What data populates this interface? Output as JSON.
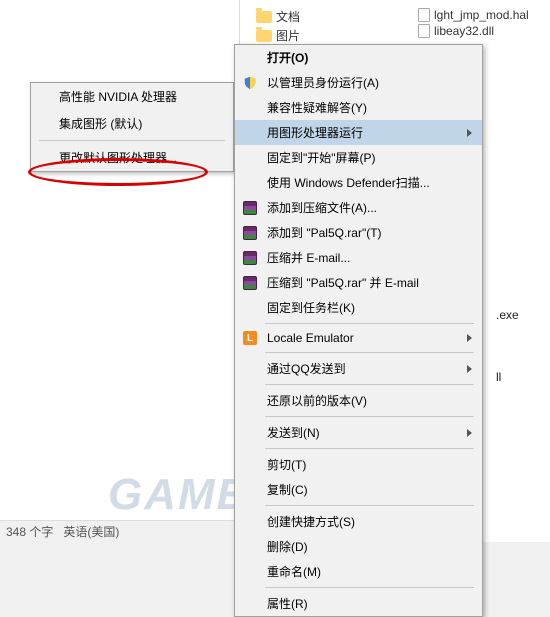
{
  "background": {
    "folders": [
      "文档",
      "图片"
    ],
    "files": [
      "lght_jmp_mod.hal",
      "libeay32.dll"
    ],
    "ext_exe": ".exe",
    "ext_ll": "ll"
  },
  "submenu": {
    "items": [
      {
        "label": "高性能 NVIDIA 处理器"
      },
      {
        "label": "集成图形   (默认)"
      },
      {
        "label": "更改默认图形处理器..."
      }
    ]
  },
  "ctxmenu": {
    "items": [
      {
        "label": "打开(O)",
        "bold": true
      },
      {
        "label": "以管理员身份运行(A)",
        "icon": "shield"
      },
      {
        "label": "兼容性疑难解答(Y)"
      },
      {
        "label": "用图形处理器运行",
        "arrow": true,
        "highlighted": true
      },
      {
        "label": "固定到\"开始\"屏幕(P)"
      },
      {
        "label": "使用 Windows Defender扫描..."
      },
      {
        "label": "添加到压缩文件(A)...",
        "icon": "winrar"
      },
      {
        "label": "添加到 \"Pal5Q.rar\"(T)",
        "icon": "winrar"
      },
      {
        "label": "压缩并 E-mail...",
        "icon": "winrar"
      },
      {
        "label": "压缩到 \"Pal5Q.rar\" 并 E-mail",
        "icon": "winrar"
      },
      {
        "label": "固定到任务栏(K)"
      },
      {
        "sep": true
      },
      {
        "label": "Locale Emulator",
        "icon": "L",
        "arrow": true
      },
      {
        "sep": true
      },
      {
        "label": "通过QQ发送到",
        "arrow": true
      },
      {
        "sep": true
      },
      {
        "label": "还原以前的版本(V)"
      },
      {
        "sep": true
      },
      {
        "label": "发送到(N)",
        "arrow": true
      },
      {
        "sep": true
      },
      {
        "label": "剪切(T)"
      },
      {
        "label": "复制(C)"
      },
      {
        "sep": true
      },
      {
        "label": "创建快捷方式(S)"
      },
      {
        "label": "删除(D)"
      },
      {
        "label": "重命名(M)"
      },
      {
        "sep": true
      },
      {
        "label": "属性(R)"
      }
    ]
  },
  "statusbar": {
    "chars": "348 个字",
    "lang": "英语(美国)"
  },
  "watermark": "GAMERSKY",
  "icon_L_glyph": "L"
}
